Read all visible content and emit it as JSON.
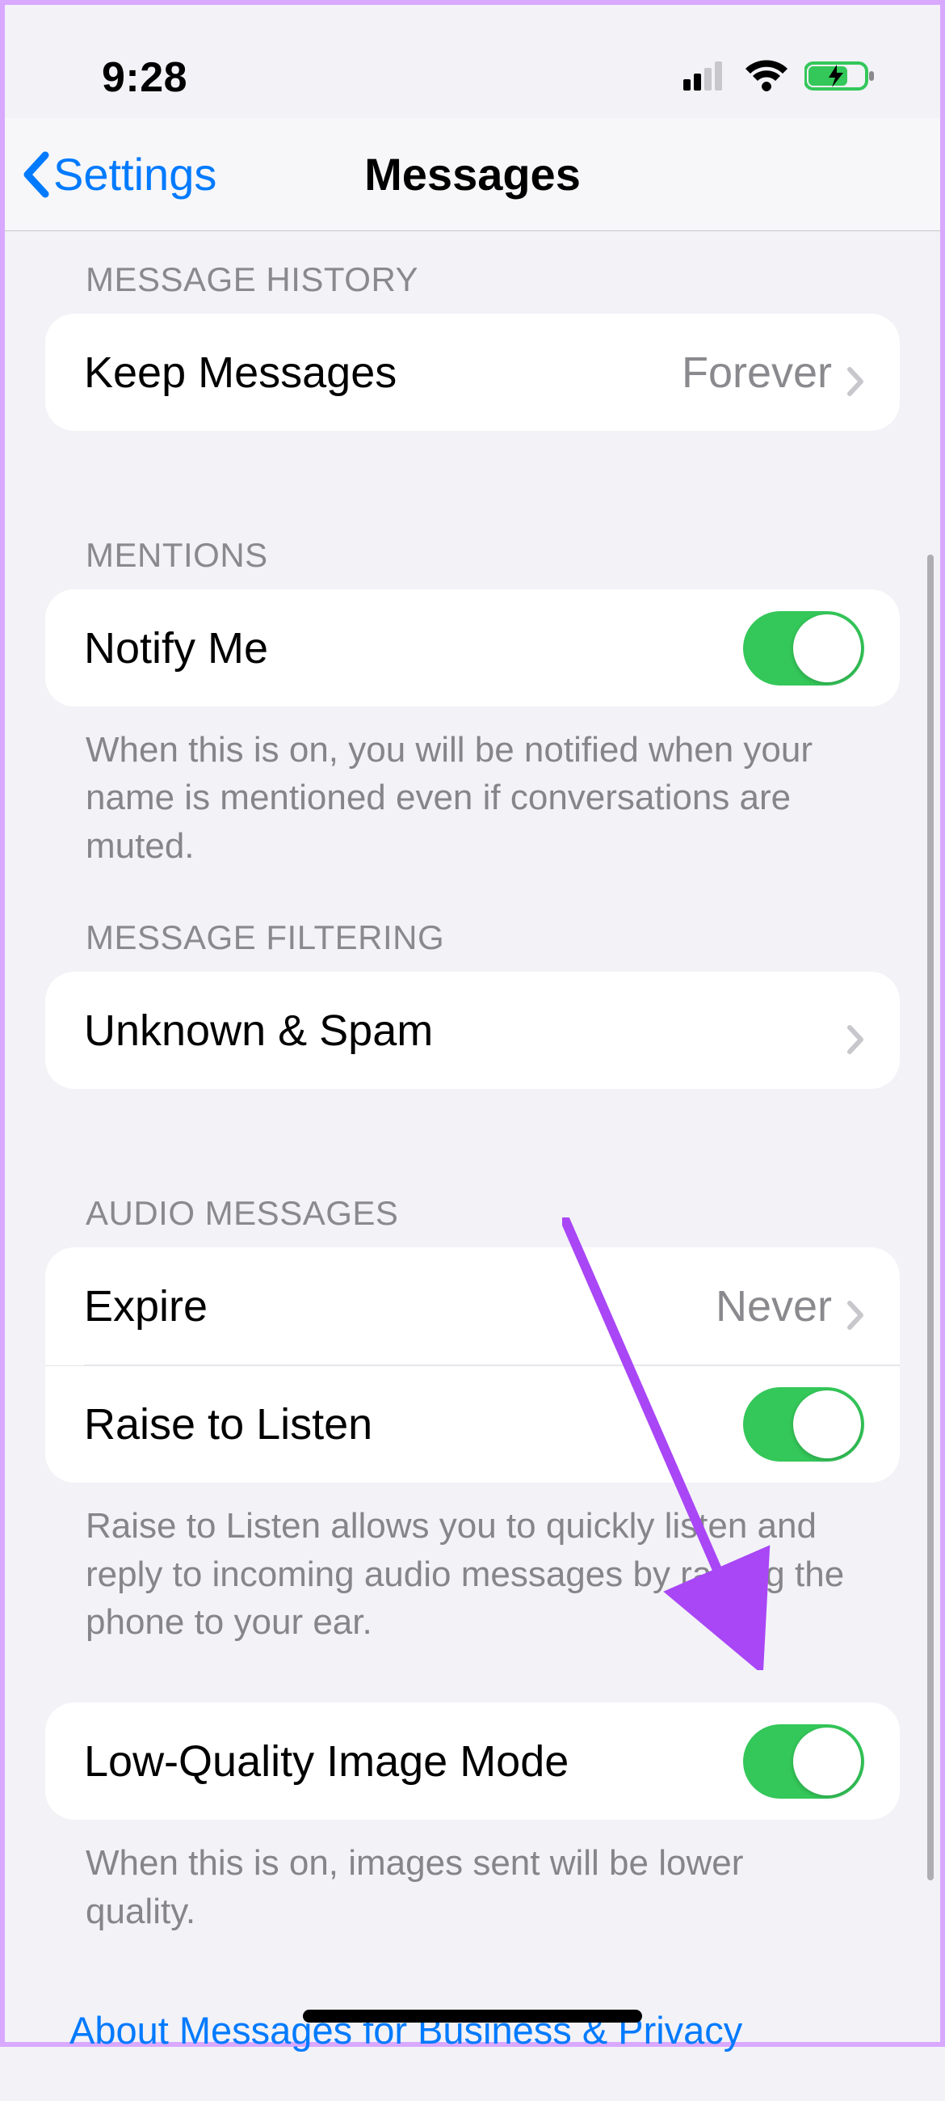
{
  "status": {
    "time": "9:28"
  },
  "nav": {
    "back_label": "Settings",
    "title": "Messages"
  },
  "sections": {
    "history": {
      "header": "MESSAGE HISTORY",
      "keep_messages": {
        "label": "Keep Messages",
        "value": "Forever"
      }
    },
    "mentions": {
      "header": "MENTIONS",
      "notify_me": {
        "label": "Notify Me",
        "on": true
      },
      "footer": "When this is on, you will be notified when your name is mentioned even if conversations are muted."
    },
    "filtering": {
      "header": "MESSAGE FILTERING",
      "unknown_spam": {
        "label": "Unknown & Spam"
      }
    },
    "audio": {
      "header": "AUDIO MESSAGES",
      "expire": {
        "label": "Expire",
        "value": "Never"
      },
      "raise_to_listen": {
        "label": "Raise to Listen",
        "on": true
      },
      "footer": "Raise to Listen allows you to quickly listen and reply to incoming audio messages by raising the phone to your ear."
    },
    "low_quality": {
      "label": "Low-Quality Image Mode",
      "on": true,
      "footer": "When this is on, images sent will be lower quality."
    }
  },
  "link": "About Messages for Business & Privacy",
  "colors": {
    "toggle_on": "#34c759",
    "link": "#007aff",
    "annotation_arrow": "#a946f6"
  }
}
